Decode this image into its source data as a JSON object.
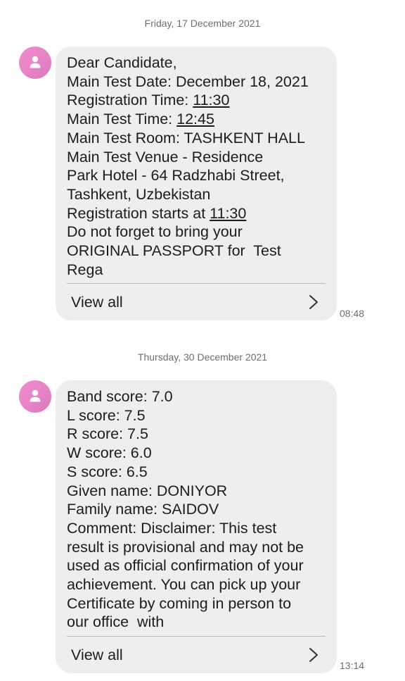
{
  "conversation": [
    {
      "date": "Friday, 17 December 2021",
      "lines": [
        {
          "pre": "Dear Candidate,"
        },
        {
          "pre": "Main Test Date: December 18, 2021"
        },
        {
          "pre": "Registration Time: ",
          "u": "11:30"
        },
        {
          "pre": "Main Test Time: ",
          "u": "12:45"
        },
        {
          "pre": "Main Test Room: TASHKENT HALL"
        },
        {
          "pre": "Main Test Venue - Residence"
        },
        {
          "pre": "Park Hotel - 64 Radzhabi Street,"
        },
        {
          "pre": "Tashkent, Uzbekistan"
        },
        {
          "pre": "Registration starts at ",
          "u": "11:30"
        },
        {
          "pre": "Do not forget to bring your"
        },
        {
          "pre": "ORIGINAL PASSPORT for  Test"
        },
        {
          "pre": "Rega"
        }
      ],
      "view_all": "View all",
      "time": "08:48"
    },
    {
      "date": "Thursday, 30 December 2021",
      "lines": [
        {
          "pre": "Band score: 7.0"
        },
        {
          "pre": "L score: 7.5"
        },
        {
          "pre": "R score: 7.5"
        },
        {
          "pre": "W score: 6.0"
        },
        {
          "pre": "S score: 6.5"
        },
        {
          "pre": "Given name: DONIYOR"
        },
        {
          "pre": "Family name: SAIDOV"
        },
        {
          "pre": "Comment: Disclaimer: This test"
        },
        {
          "pre": "result is provisional and may not be"
        },
        {
          "pre": "used as official confirmation of your"
        },
        {
          "pre": "achievement. You can pick up your"
        },
        {
          "pre": "Certificate by coming in person to"
        },
        {
          "pre": "our office  with"
        }
      ],
      "view_all": "View all",
      "time": "13:14"
    }
  ],
  "colors": {
    "bubble": "#eeeeee",
    "avatar": "#e884c6",
    "meta_text": "#6e6e6e"
  },
  "icons": [
    "person-icon",
    "chevron-right-icon"
  ]
}
